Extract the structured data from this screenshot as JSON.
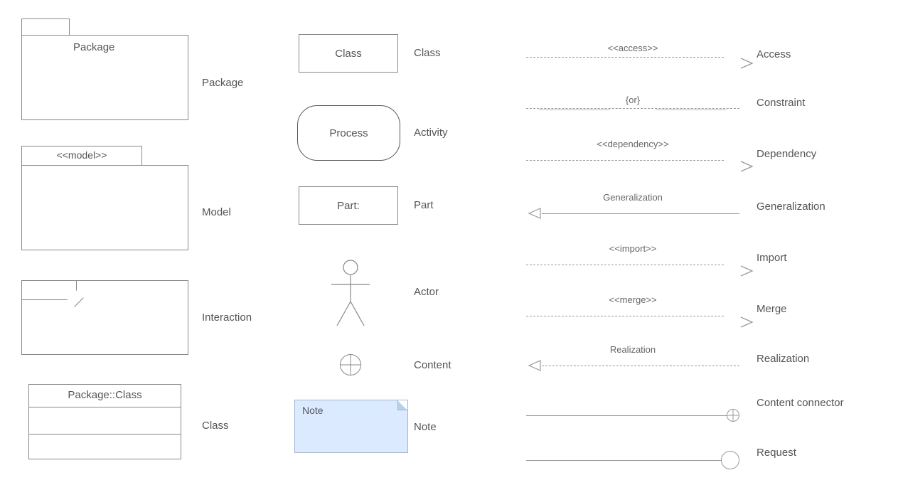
{
  "col1": {
    "package": {
      "text": "Package",
      "label": "Package"
    },
    "model": {
      "tab": "<<model>>",
      "label": "Model"
    },
    "interaction": {
      "label": "Interaction"
    },
    "classTable": {
      "title": "Package::Class",
      "label": "Class"
    }
  },
  "col2": {
    "class": {
      "text": "Class",
      "label": "Class"
    },
    "activity": {
      "text": "Process",
      "label": "Activity"
    },
    "part": {
      "text": "Part:",
      "label": "Part"
    },
    "actor": {
      "label": "Actor"
    },
    "content": {
      "label": "Content"
    },
    "note": {
      "text": "Note",
      "label": "Note"
    }
  },
  "col3": {
    "access": {
      "lineLabel": "<<access>>",
      "label": "Access"
    },
    "constraint": {
      "lineLabel": "{or}",
      "label": "Constraint"
    },
    "dependency": {
      "lineLabel": "<<dependency>>",
      "label": "Dependency"
    },
    "generalization": {
      "lineLabel": "Generalization",
      "label": "Generalization"
    },
    "import": {
      "lineLabel": "<<import>>",
      "label": "Import"
    },
    "merge": {
      "lineLabel": "<<merge>>",
      "label": "Merge"
    },
    "realization": {
      "lineLabel": "Realization",
      "label": "Realization"
    },
    "contentConnector": {
      "label": "Content connector"
    },
    "request": {
      "label": "Request"
    }
  }
}
